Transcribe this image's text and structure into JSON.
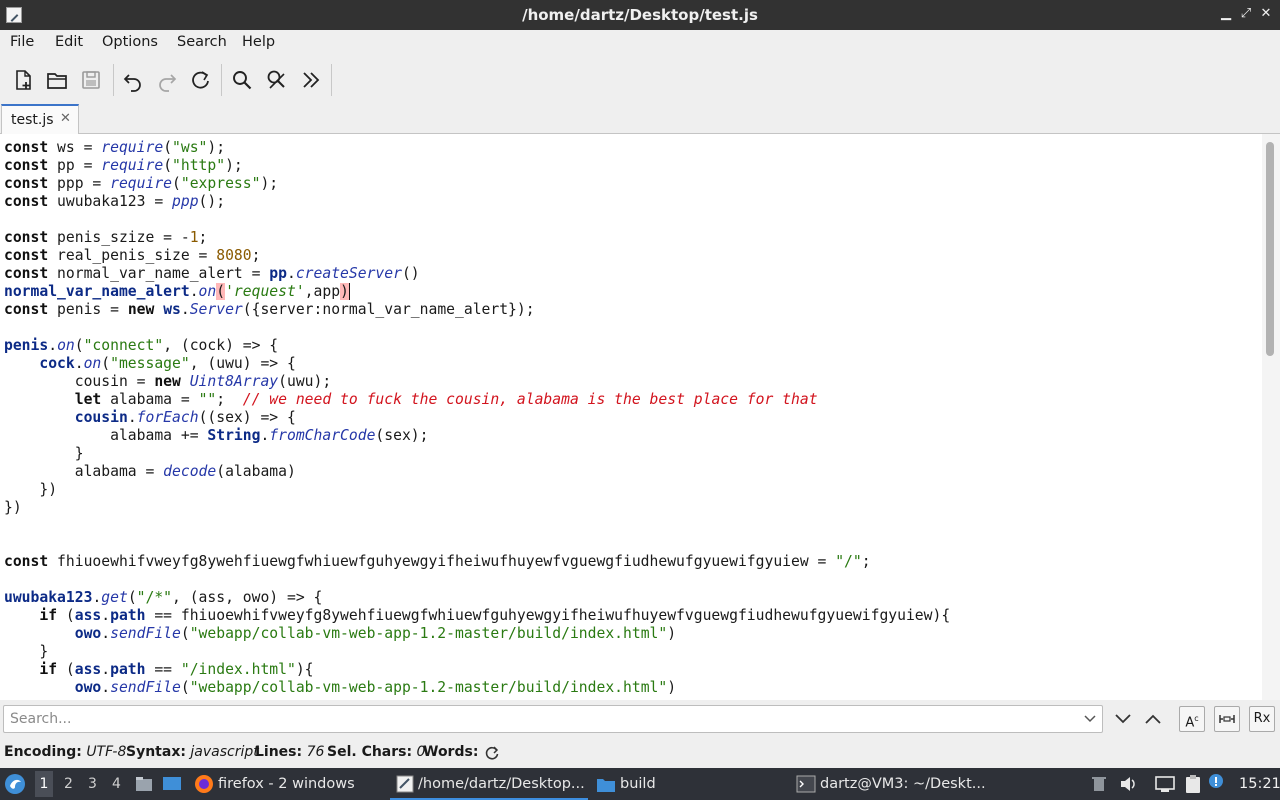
{
  "window": {
    "title": "/home/dartz/Desktop/test.js"
  },
  "menu": {
    "file": "File",
    "edit": "Edit",
    "options": "Options",
    "search": "Search",
    "help": "Help"
  },
  "tabs": [
    {
      "label": "test.js"
    }
  ],
  "editor": {
    "language": "javascript",
    "lines": [
      [
        [
          "k",
          "const"
        ],
        [
          "t",
          " ws = "
        ],
        [
          "f",
          "require"
        ],
        [
          "t",
          "("
        ],
        [
          "s",
          "\"ws\""
        ],
        [
          "t",
          ");"
        ]
      ],
      [
        [
          "k",
          "const"
        ],
        [
          "t",
          " pp = "
        ],
        [
          "f",
          "require"
        ],
        [
          "t",
          "("
        ],
        [
          "s",
          "\"http\""
        ],
        [
          "t",
          ");"
        ]
      ],
      [
        [
          "k",
          "const"
        ],
        [
          "t",
          " ppp = "
        ],
        [
          "f",
          "require"
        ],
        [
          "t",
          "("
        ],
        [
          "s",
          "\"express\""
        ],
        [
          "t",
          ");"
        ]
      ],
      [
        [
          "k",
          "const"
        ],
        [
          "t",
          " uwubaka123 = "
        ],
        [
          "f",
          "ppp"
        ],
        [
          "t",
          "();"
        ]
      ],
      [],
      [
        [
          "k",
          "const"
        ],
        [
          "t",
          " penis_szize = -"
        ],
        [
          "n",
          "1"
        ],
        [
          "t",
          ";"
        ]
      ],
      [
        [
          "k",
          "const"
        ],
        [
          "t",
          " real_penis_size = "
        ],
        [
          "n",
          "8080"
        ],
        [
          "t",
          ";"
        ]
      ],
      [
        [
          "k",
          "const"
        ],
        [
          "t",
          " normal_var_name_alert = "
        ],
        [
          "o",
          "pp"
        ],
        [
          "t",
          "."
        ],
        [
          "f",
          "createServer"
        ],
        [
          "t",
          "()"
        ]
      ],
      [
        [
          "o",
          "normal_var_name_alert"
        ],
        [
          "t",
          "."
        ],
        [
          "f",
          "on"
        ],
        [
          "hl",
          "("
        ],
        [
          "si",
          "'request'"
        ],
        [
          "t",
          ",app"
        ],
        [
          "hlc",
          ")"
        ]
      ],
      [
        [
          "k",
          "const"
        ],
        [
          "t",
          " penis = "
        ],
        [
          "k",
          "new"
        ],
        [
          "t",
          " "
        ],
        [
          "o",
          "ws"
        ],
        [
          "t",
          "."
        ],
        [
          "f",
          "Server"
        ],
        [
          "t",
          "({server:normal_var_name_alert});"
        ]
      ],
      [],
      [
        [
          "o",
          "penis"
        ],
        [
          "t",
          "."
        ],
        [
          "f",
          "on"
        ],
        [
          "t",
          "("
        ],
        [
          "s",
          "\"connect\""
        ],
        [
          "t",
          ", (cock) => {"
        ]
      ],
      [
        [
          "t",
          "    "
        ],
        [
          "o",
          "cock"
        ],
        [
          "t",
          "."
        ],
        [
          "f",
          "on"
        ],
        [
          "t",
          "("
        ],
        [
          "s",
          "\"message\""
        ],
        [
          "t",
          ", (uwu) => {"
        ]
      ],
      [
        [
          "t",
          "        cousin = "
        ],
        [
          "k",
          "new"
        ],
        [
          "t",
          " "
        ],
        [
          "f",
          "Uint8Array"
        ],
        [
          "t",
          "(uwu);"
        ]
      ],
      [
        [
          "t",
          "        "
        ],
        [
          "k",
          "let"
        ],
        [
          "t",
          " alabama = "
        ],
        [
          "s",
          "\"\""
        ],
        [
          "t",
          ";  "
        ],
        [
          "c",
          "// we need to fuck the cousin, alabama is the best place for that"
        ]
      ],
      [
        [
          "t",
          "        "
        ],
        [
          "o",
          "cousin"
        ],
        [
          "t",
          "."
        ],
        [
          "f",
          "forEach"
        ],
        [
          "t",
          "((sex) => {"
        ]
      ],
      [
        [
          "t",
          "            alabama += "
        ],
        [
          "o",
          "String"
        ],
        [
          "t",
          "."
        ],
        [
          "f",
          "fromCharCode"
        ],
        [
          "t",
          "(sex);"
        ]
      ],
      [
        [
          "t",
          "        }"
        ]
      ],
      [
        [
          "t",
          "        alabama = "
        ],
        [
          "f",
          "decode"
        ],
        [
          "t",
          "(alabama)"
        ]
      ],
      [
        [
          "t",
          "    })"
        ]
      ],
      [
        [
          "t",
          "})"
        ]
      ],
      [],
      [],
      [
        [
          "k",
          "const"
        ],
        [
          "t",
          " fhiuoewhifvweyfg8ywehfiuewgfwhiuewfguhyewgyifheiwufhuyewfvguewgfiudhewufgyuewifgyuiew = "
        ],
        [
          "s",
          "\"/\""
        ],
        [
          "t",
          ";"
        ]
      ],
      [],
      [
        [
          "o",
          "uwubaka123"
        ],
        [
          "t",
          "."
        ],
        [
          "f",
          "get"
        ],
        [
          "t",
          "("
        ],
        [
          "s",
          "\"/*\""
        ],
        [
          "t",
          ", (ass, owo) => {"
        ]
      ],
      [
        [
          "t",
          "    "
        ],
        [
          "k",
          "if"
        ],
        [
          "t",
          " ("
        ],
        [
          "o",
          "ass"
        ],
        [
          "t",
          "."
        ],
        [
          "o",
          "path"
        ],
        [
          "t",
          " == fhiuoewhifvweyfg8ywehfiuewgfwhiuewfguhyewgyifheiwufhuyewfvguewgfiudhewufgyuewifgyuiew){"
        ]
      ],
      [
        [
          "t",
          "        "
        ],
        [
          "o",
          "owo"
        ],
        [
          "t",
          "."
        ],
        [
          "f",
          "sendFile"
        ],
        [
          "t",
          "("
        ],
        [
          "s",
          "\"webapp/collab-vm-web-app-1.2-master/build/index.html\""
        ],
        [
          "t",
          ")"
        ]
      ],
      [
        [
          "t",
          "    }"
        ]
      ],
      [
        [
          "t",
          "    "
        ],
        [
          "k",
          "if"
        ],
        [
          "t",
          " ("
        ],
        [
          "o",
          "ass"
        ],
        [
          "t",
          "."
        ],
        [
          "o",
          "path"
        ],
        [
          "t",
          " == "
        ],
        [
          "s",
          "\"/index.html\""
        ],
        [
          "t",
          "){"
        ]
      ],
      [
        [
          "t",
          "        "
        ],
        [
          "o",
          "owo"
        ],
        [
          "t",
          "."
        ],
        [
          "f",
          "sendFile"
        ],
        [
          "t",
          "("
        ],
        [
          "s",
          "\"webapp/collab-vm-web-app-1.2-master/build/index.html\""
        ],
        [
          "t",
          ")"
        ]
      ]
    ]
  },
  "search": {
    "placeholder": "Search...",
    "case_label": "A",
    "regex_label": "Rx"
  },
  "status": {
    "encoding_label": "Encoding:",
    "encoding": "UTF-8",
    "syntax_label": "Syntax:",
    "syntax": "javascript",
    "lines_label": "Lines:",
    "lines": "76",
    "selchars_label": "Sel. Chars:",
    "selchars": "0",
    "words_label": "Words:"
  },
  "taskbar": {
    "workspaces": [
      "1",
      "2",
      "3",
      "4"
    ],
    "tasks": {
      "firefox": "firefox - 2 windows",
      "editor": "/home/dartz/Desktop...",
      "build": "build",
      "terminal": "dartz@VM3: ~/Deskt..."
    },
    "clock": "15:21"
  },
  "colors": {
    "accent": "#3b74c9",
    "keyword": "#101010",
    "function": "#2638a8",
    "string": "#2a7a12",
    "number": "#8a5a00",
    "comment": "#d2141e",
    "object": "#0c2a86",
    "bracket_highlight": "#ffb8b8"
  }
}
